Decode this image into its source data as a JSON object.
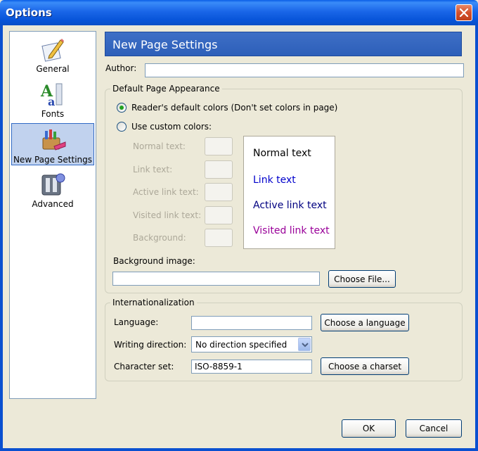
{
  "window": {
    "title": "Options"
  },
  "sidebar": {
    "items": [
      {
        "label": "General",
        "icon": "pencil-paper-icon",
        "selected": false
      },
      {
        "label": "Fonts",
        "icon": "fonts-icon",
        "selected": false
      },
      {
        "label": "New Page Settings",
        "icon": "crayons-icon",
        "selected": true
      },
      {
        "label": "Advanced",
        "icon": "advanced-icon",
        "selected": false
      }
    ]
  },
  "header": {
    "title": "New Page Settings"
  },
  "author": {
    "label": "Author:",
    "value": ""
  },
  "appearance": {
    "group_title": "Default Page Appearance",
    "radio_default": "Reader's default colors (Don't set colors in page)",
    "radio_custom": "Use custom colors:",
    "selected": "default",
    "color_labels": [
      "Normal text:",
      "Link text:",
      "Active link text:",
      "Visited link text:",
      "Background:"
    ],
    "preview": {
      "normal": "Normal text",
      "link": "Link text",
      "active": "Active link text",
      "visited": "Visited link text",
      "colors": {
        "normal": "#000000",
        "link": "#0000cc",
        "active": "#000080",
        "visited": "#990099"
      }
    },
    "bg_image_label": "Background image:",
    "bg_image_value": "",
    "choose_file": "Choose File..."
  },
  "intl": {
    "group_title": "Internationalization",
    "language_label": "Language:",
    "language_value": "",
    "choose_language": "Choose a language",
    "writing_label": "Writing direction:",
    "writing_value": "No direction specified",
    "charset_label": "Character set:",
    "charset_value": "ISO-8859-1",
    "choose_charset": "Choose a charset"
  },
  "buttons": {
    "ok": "OK",
    "cancel": "Cancel"
  }
}
